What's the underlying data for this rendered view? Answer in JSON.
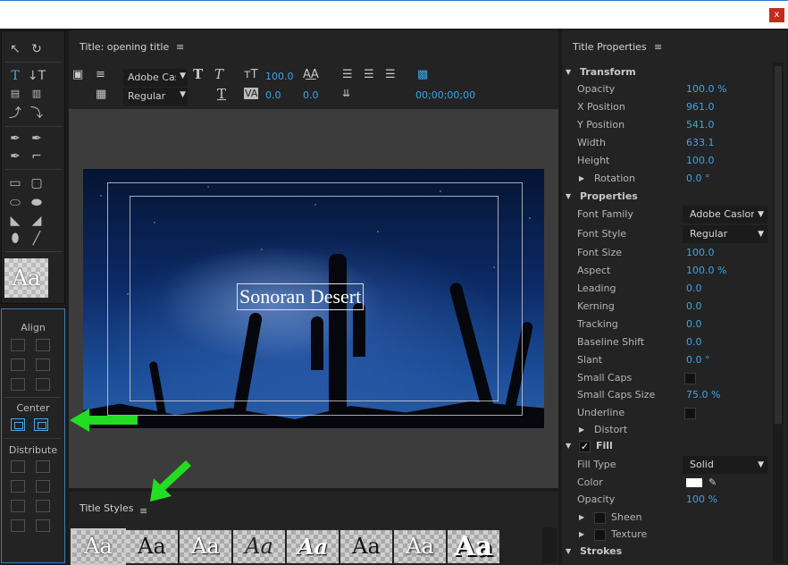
{
  "window": {
    "close_label": "x"
  },
  "tools": {
    "style_preview": "Aa"
  },
  "align_panel": {
    "align_label": "Align",
    "center_label": "Center",
    "distribute_label": "Distribute"
  },
  "main_panel": {
    "title": "Title: opening title",
    "menu": "≡",
    "font_family": "Adobe Caslon Pro",
    "font_style": "Regular",
    "font_size": "100.0",
    "kerning": "0.0",
    "tracking": "0.0",
    "leading": "0.0",
    "timecode": "00;00;00;00",
    "canvas_text": "Sonoran Desert"
  },
  "styles_panel": {
    "title": "Title Styles",
    "menu": "≡",
    "swatch_label": "Aa"
  },
  "properties": {
    "title": "Title Properties",
    "menu": "≡",
    "transform_label": "Transform",
    "opacity_label": "Opacity",
    "opacity_value": "100.0 %",
    "x_label": "X Position",
    "x_value": "961.0",
    "y_label": "Y Position",
    "y_value": "541.0",
    "width_label": "Width",
    "width_value": "633.1",
    "height_label": "Height",
    "height_value": "100.0",
    "rotation_label": "Rotation",
    "rotation_value": "0.0 °",
    "properties_label": "Properties",
    "font_family_label": "Font Family",
    "font_family_value": "Adobe Caslon Pro",
    "font_style_label": "Font Style",
    "font_style_value": "Regular",
    "font_size_label": "Font Size",
    "font_size_value": "100.0",
    "aspect_label": "Aspect",
    "aspect_value": "100.0 %",
    "leading_label": "Leading",
    "leading_value": "0.0",
    "kerning_label": "Kerning",
    "kerning_value": "0.0",
    "tracking_label": "Tracking",
    "tracking_value": "0.0",
    "baseline_label": "Baseline Shift",
    "baseline_value": "0.0",
    "slant_label": "Slant",
    "slant_value": "0.0 °",
    "small_caps_label": "Small Caps",
    "small_caps_size_label": "Small Caps Size",
    "small_caps_size_value": "75.0 %",
    "underline_label": "Underline",
    "distort_label": "Distort",
    "fill_label": "Fill",
    "fill_check": "✓",
    "fill_type_label": "Fill Type",
    "fill_type_value": "Solid",
    "color_label": "Color",
    "fill_opacity_label": "Opacity",
    "fill_opacity_value": "100 %",
    "sheen_label": "Sheen",
    "texture_label": "Texture",
    "strokes_label": "Strokes"
  },
  "colors": {
    "accent": "#3ea4e6",
    "annotation_arrow": "#22dd22",
    "close": "#c42b1c"
  }
}
